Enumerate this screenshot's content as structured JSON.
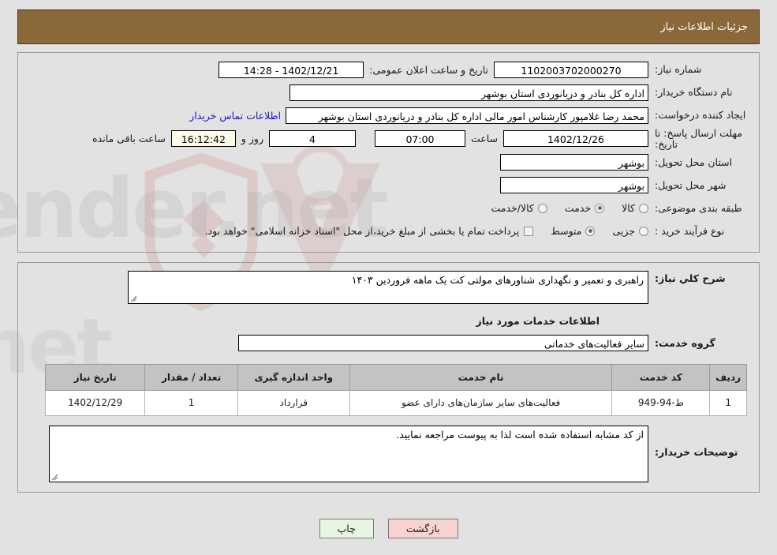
{
  "header": {
    "title": "جزئیات اطلاعات نیاز"
  },
  "colors": {
    "header_bg": "#8b6839",
    "link": "#1414dc",
    "table_header_bg": "#c3c3c3",
    "back_button_bg": "#f9d2d2",
    "print_button_bg": "#e6f6e2",
    "countdown_bg": "#fbfbe8"
  },
  "form": {
    "need_number_label": "شماره نیاز:",
    "need_number_value": "1102003702000270",
    "announce_datetime_label": "تاریخ و ساعت اعلان عمومی:",
    "announce_datetime_value": "1402/12/21 - 14:28",
    "buyer_org_label": "نام دستگاه خریدار:",
    "buyer_org_value": "اداره کل بنادر و دریانوردی استان بوشهر",
    "creator_label": "ایجاد کننده درخواست:",
    "creator_value": "محمد رضا غلامپور کارشناس امور مالی اداره کل بنادر و دریانوردی استان بوشهر",
    "contact_link": "اطلاعات تماس خریدار",
    "deadline_label": "مهلت ارسال پاسخ: تا تاریخ:",
    "deadline_date": "1402/12/26",
    "deadline_hour_label": "ساعت",
    "deadline_hour": "07:00",
    "days_value": "4",
    "days_label": "روز و",
    "remaining_time": "16:12:42",
    "remaining_label": "ساعت باقی مانده",
    "province_label": "استان محل تحویل:",
    "province_value": "بوشهر",
    "city_label": "شهر محل تحویل:",
    "city_value": "بوشهر",
    "classification_label": "طبقه بندی موضوعی:",
    "classification_options": [
      {
        "label": "کالا",
        "selected": false
      },
      {
        "label": "خدمت",
        "selected": true
      },
      {
        "label": "کالا/خدمت",
        "selected": false
      }
    ],
    "purchase_type_label": "نوع فرآیند خرید :",
    "purchase_type_options": [
      {
        "label": "جزیی",
        "selected": false
      },
      {
        "label": "متوسط",
        "selected": true
      }
    ],
    "treasury_checkbox_checked": false,
    "treasury_note": "پرداخت تمام یا بخشی از مبلغ خرید،از محل \"اسناد خزانه اسلامی\" خواهد بود."
  },
  "details": {
    "general_desc_label": "شرح کلي نیاز:",
    "general_desc_value": "راهبری و تعمیر و نگهداری شناورهای مولتی کت یک ماهه فروردین ۱۴۰۳",
    "services_section_title": "اطلاعات خدمات مورد نیاز",
    "service_group_label": "گروه خدمت:",
    "service_group_value": "سایر فعالیت‌های خدماتی",
    "buyer_notes_label": "توضیحات خریدار:",
    "buyer_notes_value": "از کد مشابه استفاده شده است لذا به پیوست مراجعه نمایید."
  },
  "table": {
    "columns": [
      "ردیف",
      "کد خدمت",
      "نام خدمت",
      "واحد اندازه گیری",
      "تعداد / مقدار",
      "تاریخ نیاز"
    ],
    "rows": [
      {
        "radif": "1",
        "code": "ط-94-949",
        "name": "فعالیت‌های سایر سازمان‌های دارای عضو",
        "unit": "قرارداد",
        "qty": "1",
        "date": "1402/12/29"
      }
    ]
  },
  "footer": {
    "back_label": "بازگشت",
    "print_label": "چاپ"
  }
}
